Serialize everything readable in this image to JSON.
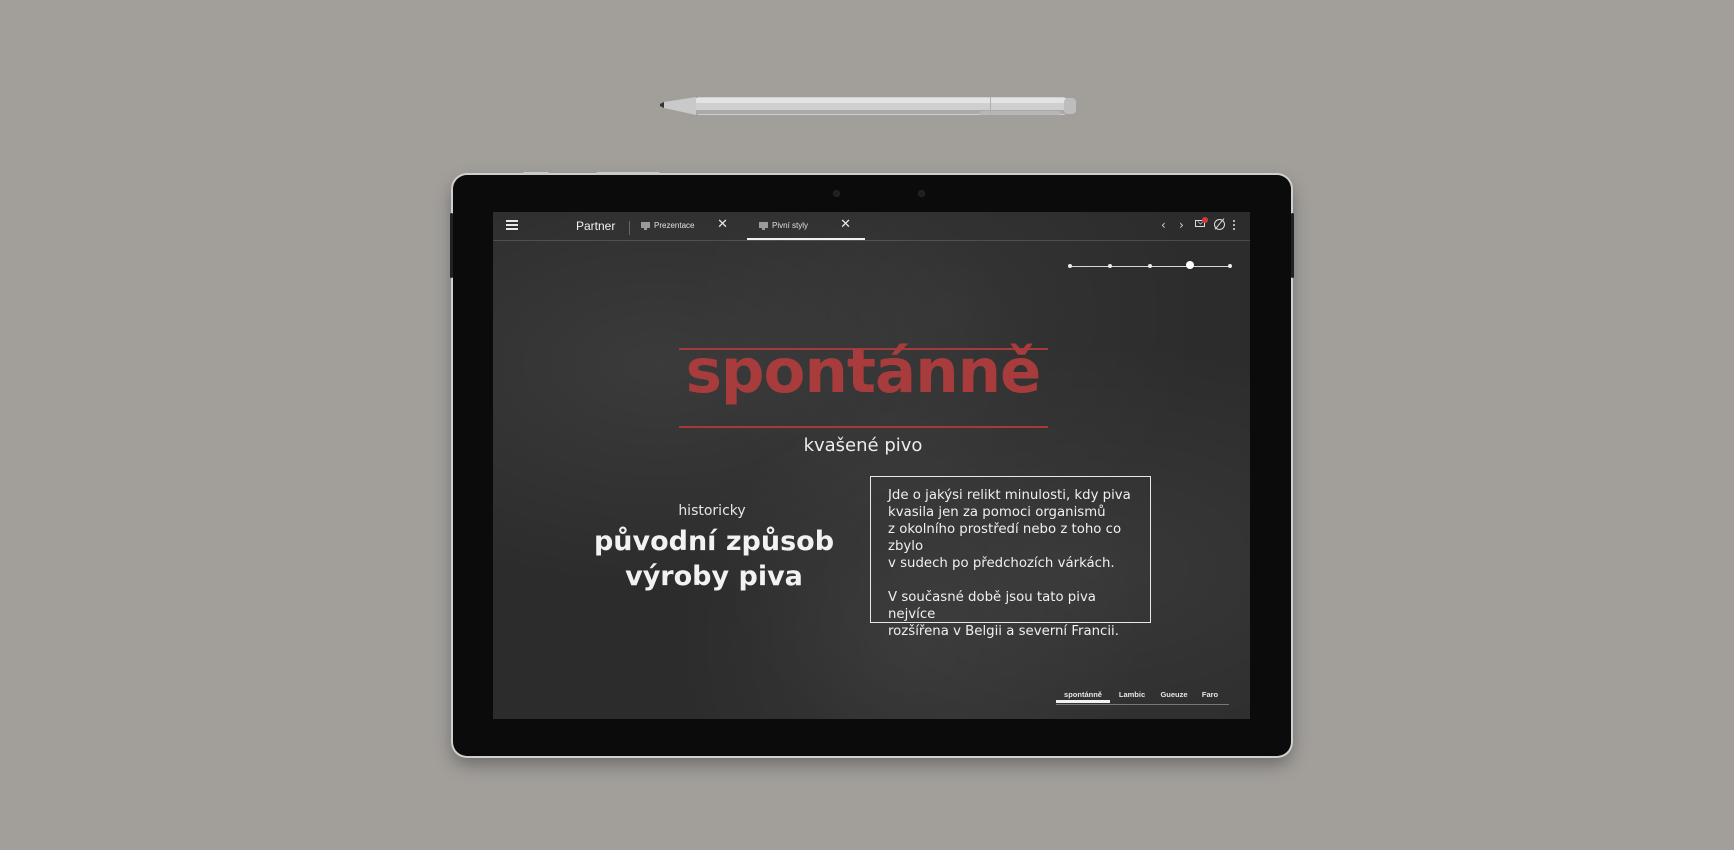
{
  "topbar": {
    "app_name": "Partner",
    "tabs": [
      {
        "label": "Prezentace",
        "close": "✕",
        "active": false
      },
      {
        "label": "Pivní styly",
        "close": "✕",
        "active": true
      }
    ],
    "notification_badge_color": "#d23a3a"
  },
  "progress": {
    "steps": 5,
    "current_step": 4
  },
  "slide": {
    "title": "spontánně",
    "title_color": "#a83c3c",
    "subtitle": "kvašené pivo",
    "left_small": "historicky",
    "left_big_line1": "původní způsob",
    "left_big_line2": "výroby piva",
    "box_paragraph1": "Jde o jakýsi relikt minulosti, kdy piva\nkvasila jen za pomoci organismů\nz okolního prostředí nebo z toho co zbylo\nv sudech po předchozích várkách.",
    "box_paragraph2": "V současné době jsou tato piva nejvíce\nrozšířena v Belgii a severní Francii."
  },
  "bottom_tabs": [
    {
      "label": "spontánně",
      "active": true
    },
    {
      "label": "Lambic",
      "active": false
    },
    {
      "label": "Gueuze",
      "active": false
    },
    {
      "label": "Faro",
      "active": false
    }
  ]
}
